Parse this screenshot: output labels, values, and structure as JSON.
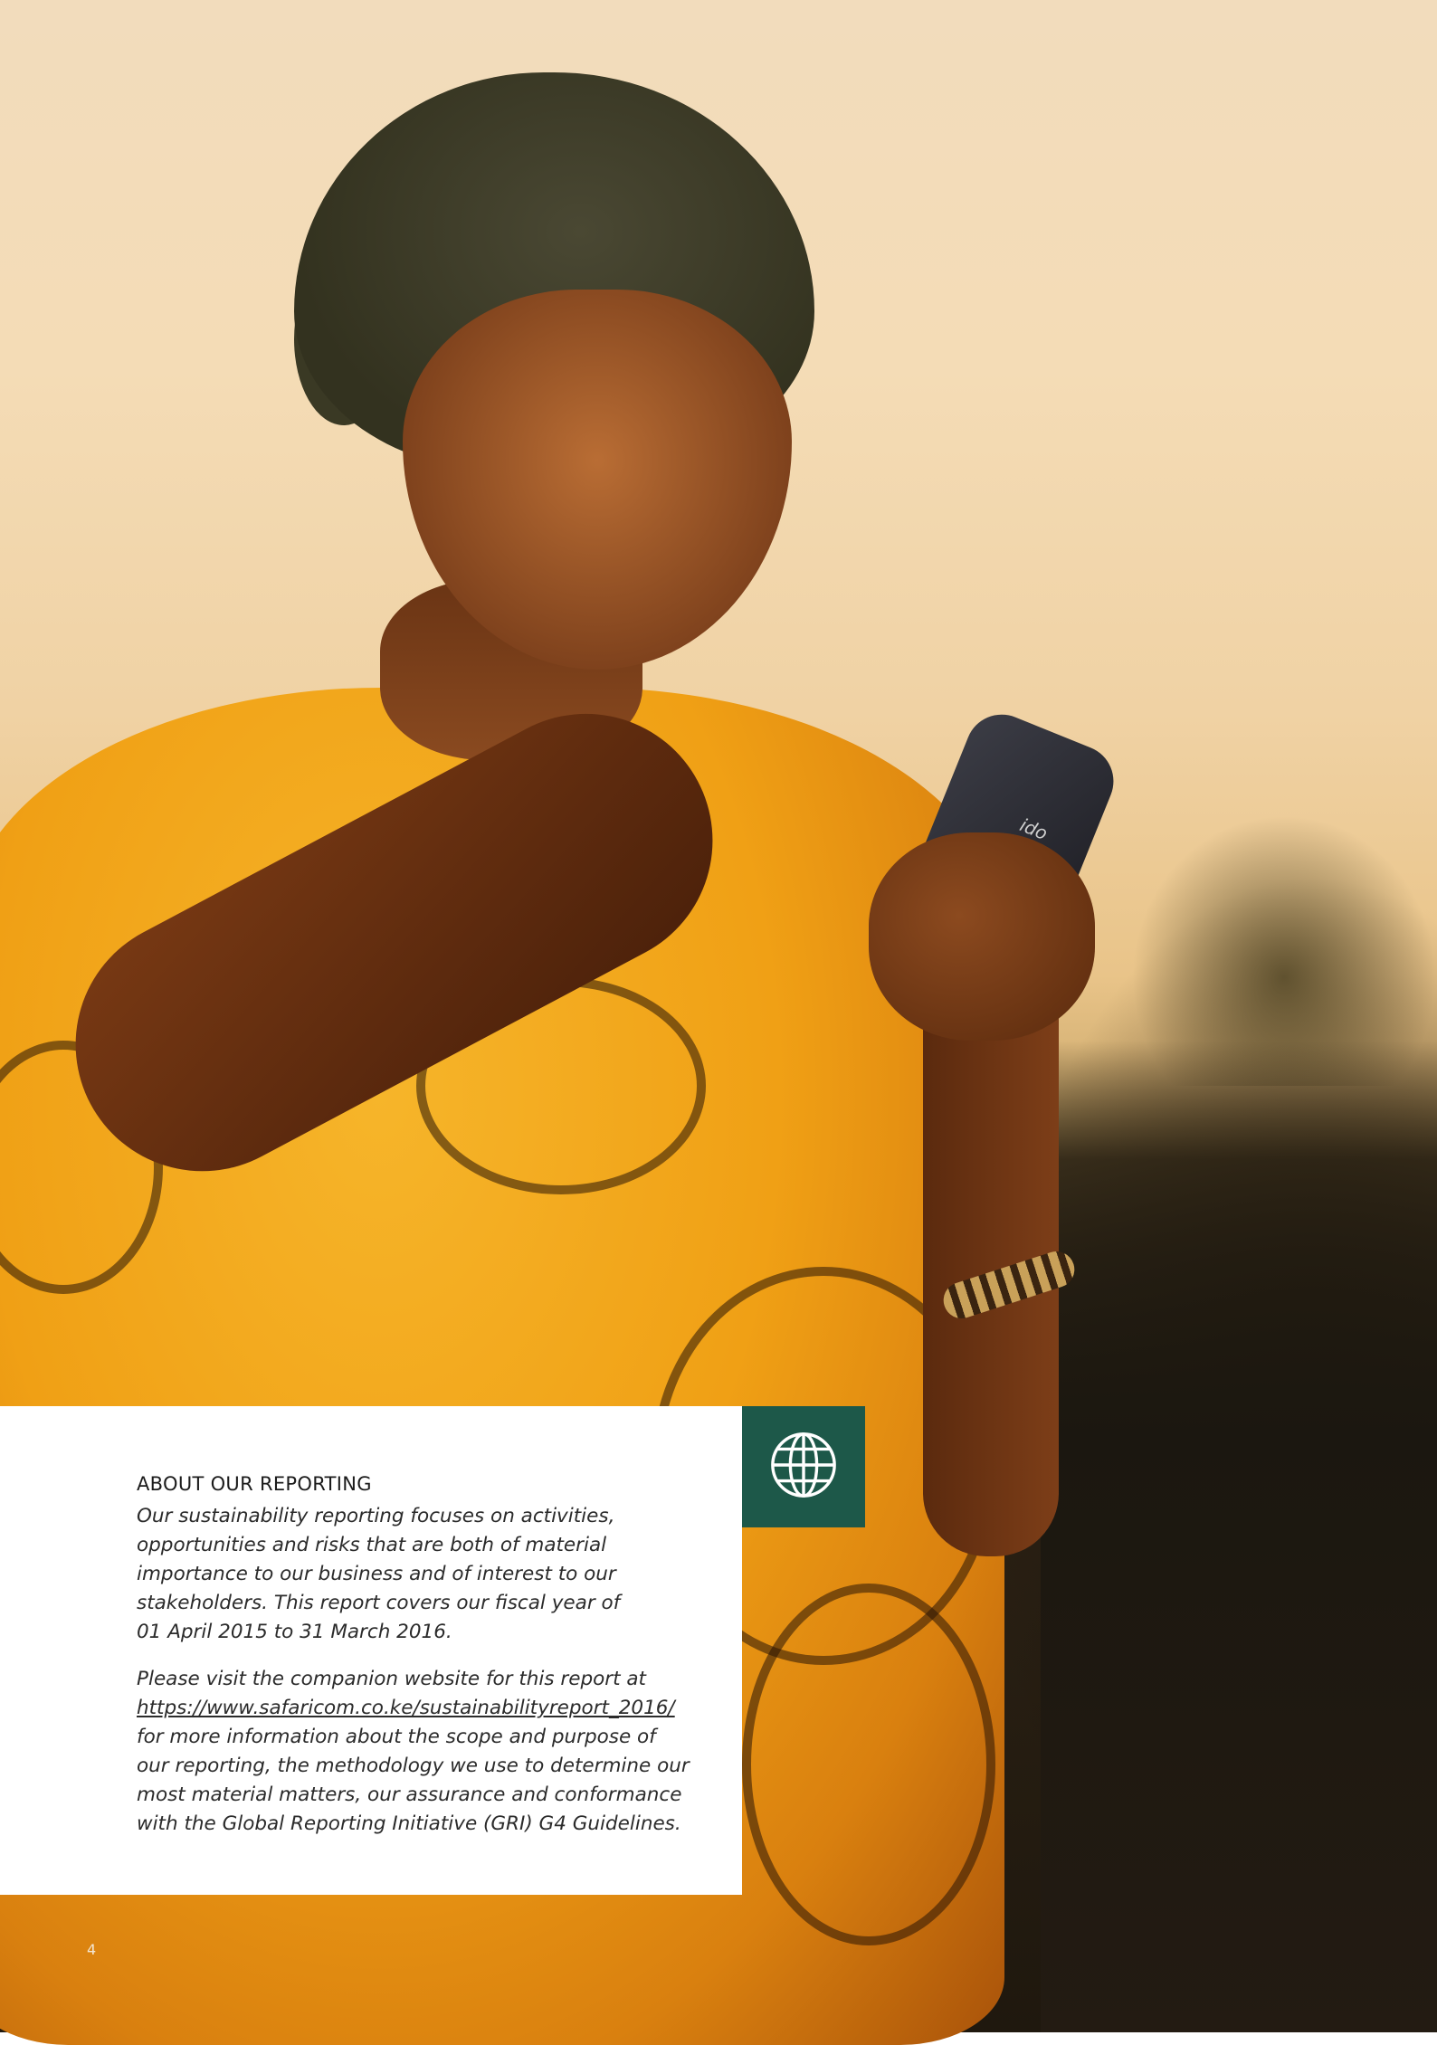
{
  "section": {
    "heading": "ABOUT OUR REPORTING",
    "paragraph1_lines": [
      "Our sustainability reporting focuses on activities,",
      "opportunities and risks that are both of material",
      "importance to our business and of interest to our",
      "stakeholders. This report covers our fiscal year of",
      "01 April 2015 to 31 March 2016."
    ],
    "paragraph2_intro": "Please visit the companion website for this report at",
    "paragraph2_link": "https://www.safaricom.co.ke/sustainabilityreport_2016/",
    "paragraph2_lines": [
      "for more information about the scope and purpose of",
      "our reporting, the methodology we use to determine our",
      "most material matters, our assurance and conformance",
      "with the Global Reporting Initiative (GRI) G4 Guidelines."
    ]
  },
  "icon": {
    "name": "globe-icon",
    "background": "#1d5849",
    "stroke": "#ffffff"
  },
  "page_number": "4",
  "photo": {
    "phone_brand": "ido"
  }
}
